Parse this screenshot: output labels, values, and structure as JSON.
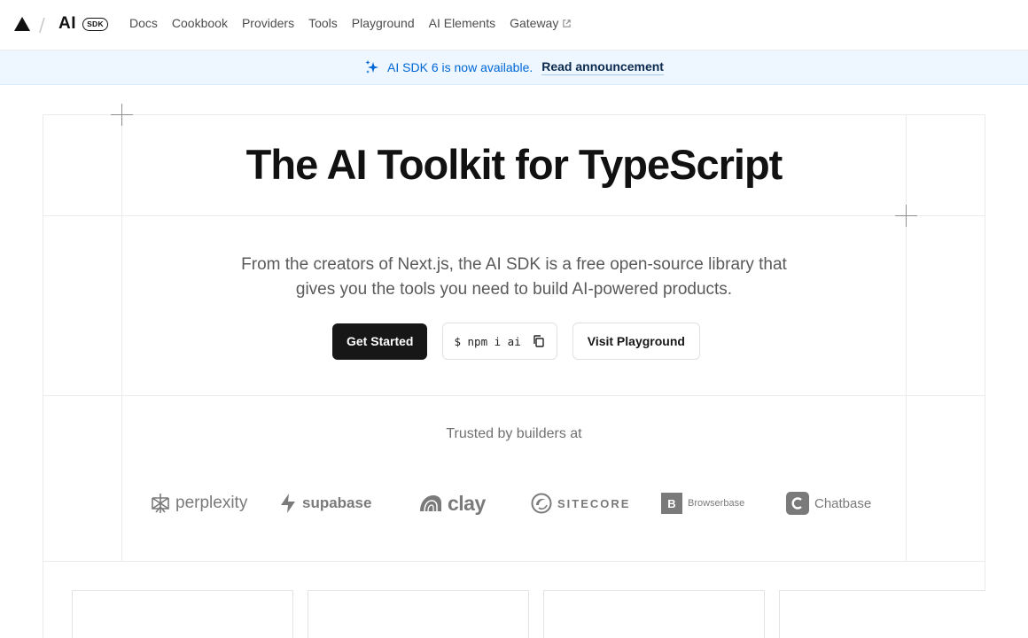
{
  "nav": {
    "brand_text": "AI",
    "brand_badge": "SDK",
    "links": [
      {
        "label": "Docs"
      },
      {
        "label": "Cookbook"
      },
      {
        "label": "Providers"
      },
      {
        "label": "Tools"
      },
      {
        "label": "Playground"
      },
      {
        "label": "AI Elements"
      },
      {
        "label": "Gateway",
        "external": true
      }
    ]
  },
  "banner": {
    "text": "AI SDK 6 is now available.",
    "link_label": "Read announcement",
    "accent_color": "#0068d6"
  },
  "hero": {
    "title": "The AI Toolkit for TypeScript",
    "subtitle": "From the creators of Next.js, the AI SDK is a free open-source library that gives you the tools you need to build AI-powered products.",
    "primary_button": "Get Started",
    "install_command": "$ npm i ai",
    "secondary_button": "Visit Playground"
  },
  "trusted": {
    "heading": "Trusted by builders at",
    "logos": [
      {
        "name": "perplexity",
        "icon": "perplexity-logo"
      },
      {
        "name": "supabase",
        "icon": "supabase-logo"
      },
      {
        "name": "clay",
        "icon": "clay-logo"
      },
      {
        "name": "SITECORE",
        "icon": "sitecore-logo"
      },
      {
        "name": "Browserbase",
        "icon": "browserbase-logo"
      },
      {
        "name": "Chatbase",
        "icon": "chatbase-logo"
      }
    ]
  },
  "colors": {
    "text_primary": "#171717",
    "border": "#ebebeb",
    "button_dark": "#171717"
  }
}
